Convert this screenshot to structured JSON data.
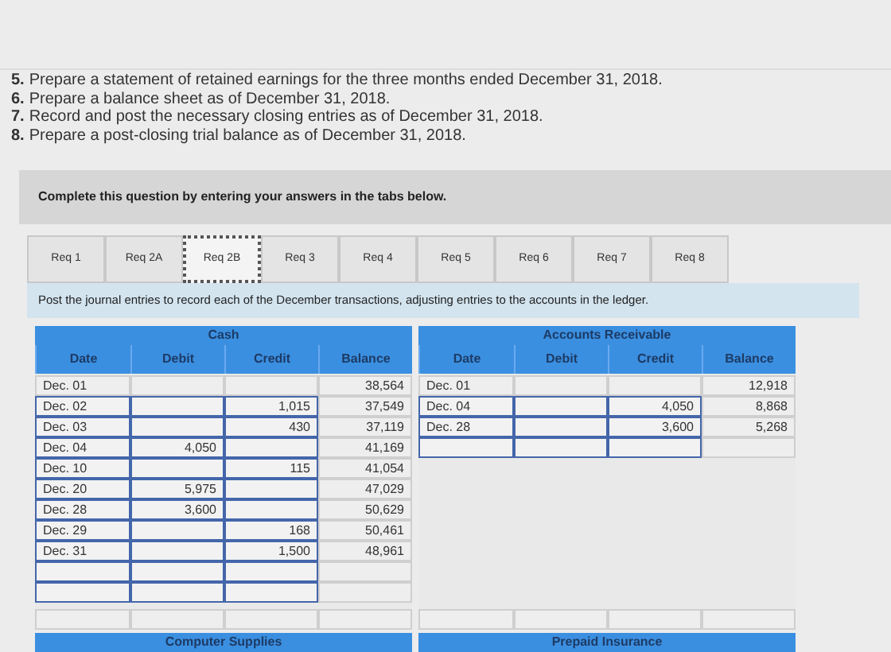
{
  "instructions": [
    {
      "number": "5.",
      "text": "Prepare a statement of retained earnings for the three months ended December 31, 2018."
    },
    {
      "number": "6.",
      "text": "Prepare a balance sheet as of December 31, 2018."
    },
    {
      "number": "7.",
      "text": "Record and post the necessary closing entries as of December 31, 2018."
    },
    {
      "number": "8.",
      "text": "Prepare a post-closing trial balance as of December 31, 2018."
    }
  ],
  "prompt": "Complete this question by entering your answers in the tabs below.",
  "tabs": [
    {
      "label": "Req 1",
      "selected": false
    },
    {
      "label": "Req 2A",
      "selected": false
    },
    {
      "label": "Req 2B",
      "selected": true
    },
    {
      "label": "Req 3",
      "selected": false
    },
    {
      "label": "Req 4",
      "selected": false
    },
    {
      "label": "Req 5",
      "selected": false
    },
    {
      "label": "Req 6",
      "selected": false
    },
    {
      "label": "Req 7",
      "selected": false
    },
    {
      "label": "Req 8",
      "selected": false
    }
  ],
  "task": "Post the journal entries to record each of the December transactions, adjusting entries to the accounts in the ledger.",
  "ledgers": [
    {
      "title": "Cash",
      "columns": [
        "Date",
        "Debit",
        "Credit",
        "Balance"
      ],
      "next_title": "Computer Supplies",
      "rows": [
        {
          "kind": "given",
          "date": "Dec. 01",
          "balance": "38,564"
        },
        {
          "kind": "entry",
          "date": "Dec. 02",
          "credit": "1,015",
          "balance": "37,549"
        },
        {
          "kind": "entry",
          "date": "Dec. 03",
          "credit": "430",
          "balance": "37,119"
        },
        {
          "kind": "entry",
          "date": "Dec. 04",
          "debit": "4,050",
          "balance": "41,169"
        },
        {
          "kind": "entry",
          "date": "Dec. 10",
          "credit": "115",
          "balance": "41,054"
        },
        {
          "kind": "entry",
          "date": "Dec. 20",
          "debit": "5,975",
          "balance": "47,029"
        },
        {
          "kind": "entry",
          "date": "Dec. 28",
          "debit": "3,600",
          "balance": "50,629"
        },
        {
          "kind": "entry",
          "date": "Dec. 29",
          "credit": "168",
          "balance": "50,461"
        },
        {
          "kind": "entry",
          "date": "Dec. 31",
          "credit": "1,500",
          "balance": "48,961"
        },
        {
          "kind": "entry"
        },
        {
          "kind": "entry"
        },
        {
          "kind": "given"
        }
      ]
    },
    {
      "title": "Accounts Receivable",
      "columns": [
        "Date",
        "Debit",
        "Credit",
        "Balance"
      ],
      "next_title": "Prepaid Insurance",
      "rows": [
        {
          "kind": "given",
          "date": "Dec. 01",
          "balance": "12,918"
        },
        {
          "kind": "entry",
          "date": "Dec. 04",
          "credit": "4,050",
          "balance": "8,868"
        },
        {
          "kind": "entry",
          "date": "Dec. 28",
          "credit": "3,600",
          "balance": "5,268"
        },
        {
          "kind": "entry"
        },
        {
          "kind": "given"
        }
      ]
    }
  ]
}
